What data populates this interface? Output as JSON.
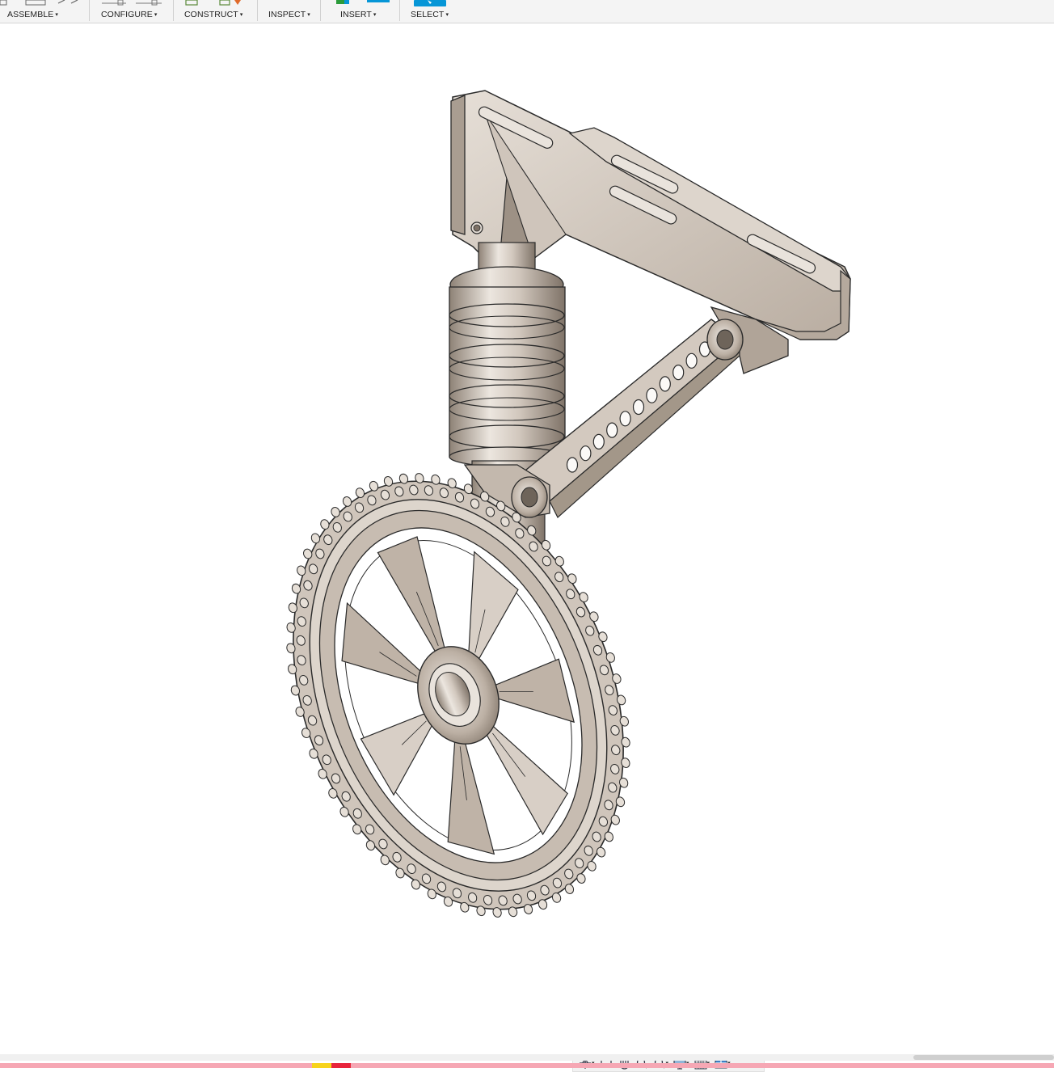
{
  "toolbar": {
    "groups": [
      {
        "label": "ASSEMBLE"
      },
      {
        "label": "CONFIGURE"
      },
      {
        "label": "CONSTRUCT"
      },
      {
        "label": "INSPECT"
      },
      {
        "label": "INSERT"
      },
      {
        "label": "SELECT"
      }
    ],
    "caret": "▾"
  },
  "colors": {
    "toolbar_bg": "#f4f4f4",
    "viewport_bg": "#ffffff",
    "model_fill": "#d6cdc4",
    "model_fill_light": "#ebe5de",
    "model_fill_dark": "#a89c90",
    "model_edge": "#2a2a2a",
    "select_accent": "#0696d7",
    "insert_accent": "#0696d7",
    "status_bar": "#f6a7b4"
  },
  "navigation_bar": {
    "tools": [
      {
        "icon": "orbit-icon",
        "dropdown": true
      },
      {
        "icon": "look-at-icon",
        "dropdown": false
      },
      {
        "icon": "pan-icon",
        "dropdown": false
      },
      {
        "icon": "zoom-icon",
        "dropdown": false
      },
      {
        "icon": "fit-icon",
        "dropdown": true
      },
      {
        "icon": "display-settings-icon",
        "dropdown": true
      },
      {
        "icon": "grid-settings-icon",
        "dropdown": true
      },
      {
        "icon": "viewports-icon",
        "dropdown": true
      }
    ]
  },
  "model": {
    "description_icon": "landing-gear-assembly",
    "parts": [
      "mount-bracket",
      "shock-absorber",
      "linkage-arm",
      "wheel",
      "tire"
    ]
  }
}
